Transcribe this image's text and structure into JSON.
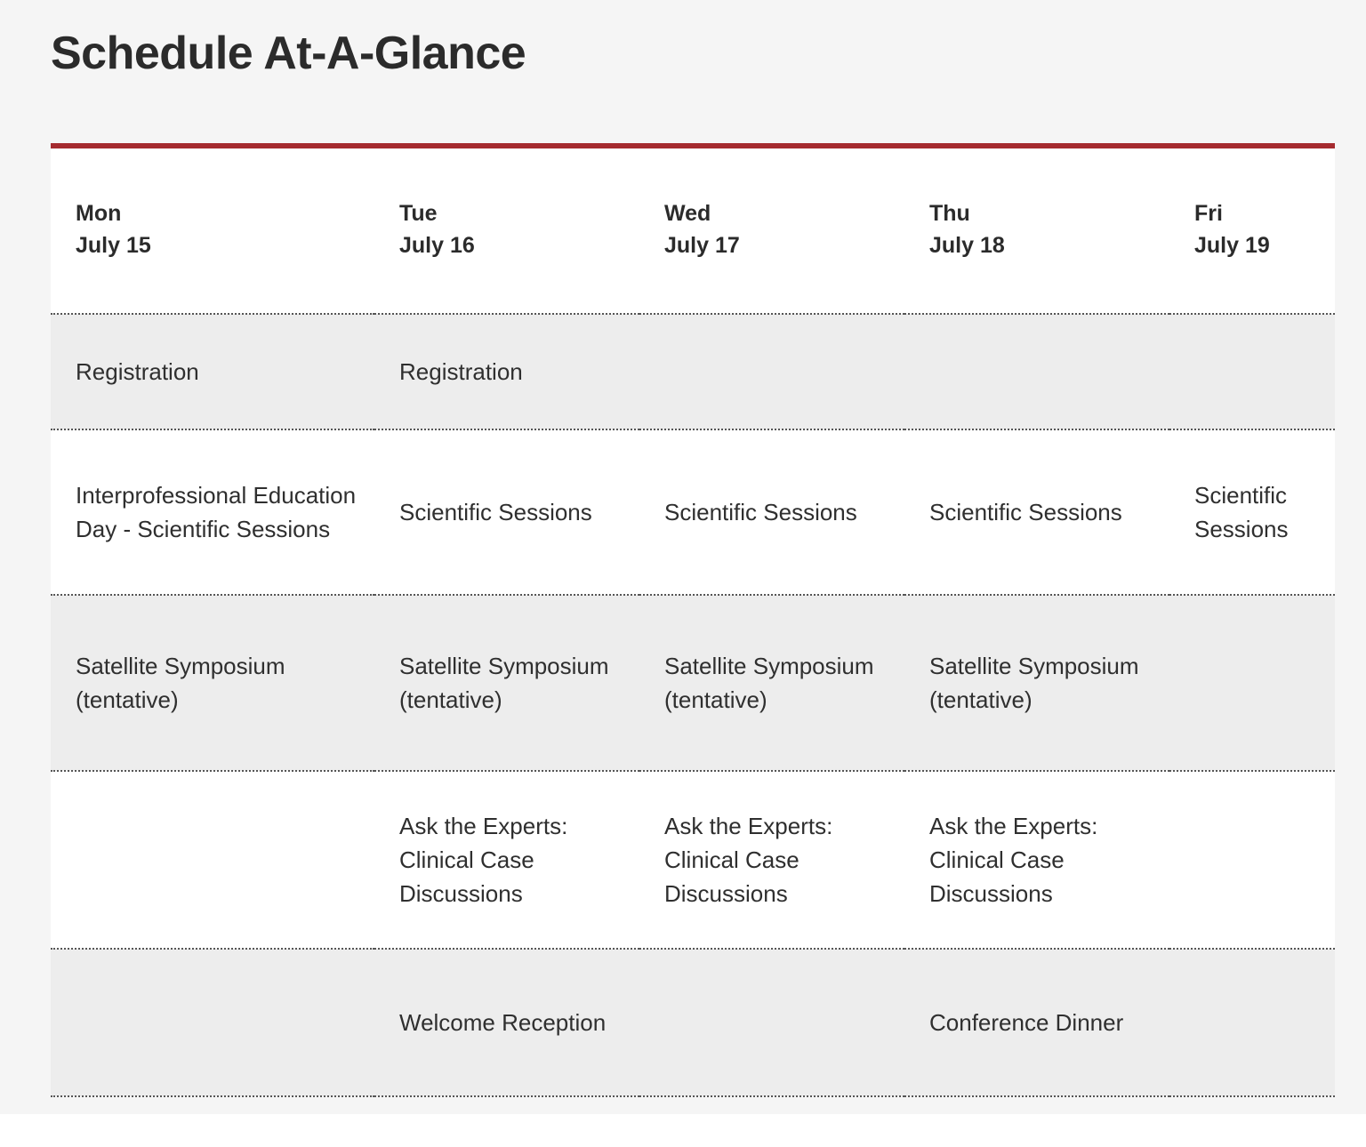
{
  "page": {
    "title": "Schedule At-A-Glance",
    "accent_color": "#a52a2f",
    "band_color": "#ededed",
    "canvas_color": "#f5f5f5",
    "text_color": "#2f2f2f"
  },
  "table": {
    "columns": [
      {
        "dow": "Mon",
        "date": "July 15"
      },
      {
        "dow": "Tue",
        "date": "July 16"
      },
      {
        "dow": "Wed",
        "date": "July 17"
      },
      {
        "dow": "Thu",
        "date": "July 18"
      },
      {
        "dow": "Fri",
        "date": "July 19"
      }
    ],
    "rows": [
      {
        "key": "registration",
        "shaded": true,
        "cells": [
          "Registration",
          "Registration",
          "",
          "",
          ""
        ]
      },
      {
        "key": "scientific-sessions",
        "shaded": false,
        "cells": [
          "Interprofessional Education Day - Scientific Sessions",
          "Scientific Sessions",
          "Scientific Sessions",
          "Scientific Sessions",
          "Scientific Sessions"
        ]
      },
      {
        "key": "satellite-symposium",
        "shaded": true,
        "cells": [
          "Satellite Symposium (tentative)",
          "Satellite Symposium (tentative)",
          "Satellite Symposium (tentative)",
          "Satellite Symposium (tentative)",
          ""
        ]
      },
      {
        "key": "ask-the-experts",
        "shaded": false,
        "cells": [
          "",
          "Ask the Experts: Clinical Case Discussions",
          "Ask the Experts: Clinical Case Discussions",
          "Ask the Experts: Clinical Case Discussions",
          ""
        ]
      },
      {
        "key": "social-events",
        "shaded": true,
        "cells": [
          "",
          "Welcome Reception",
          "",
          "Conference Dinner",
          ""
        ]
      }
    ]
  }
}
